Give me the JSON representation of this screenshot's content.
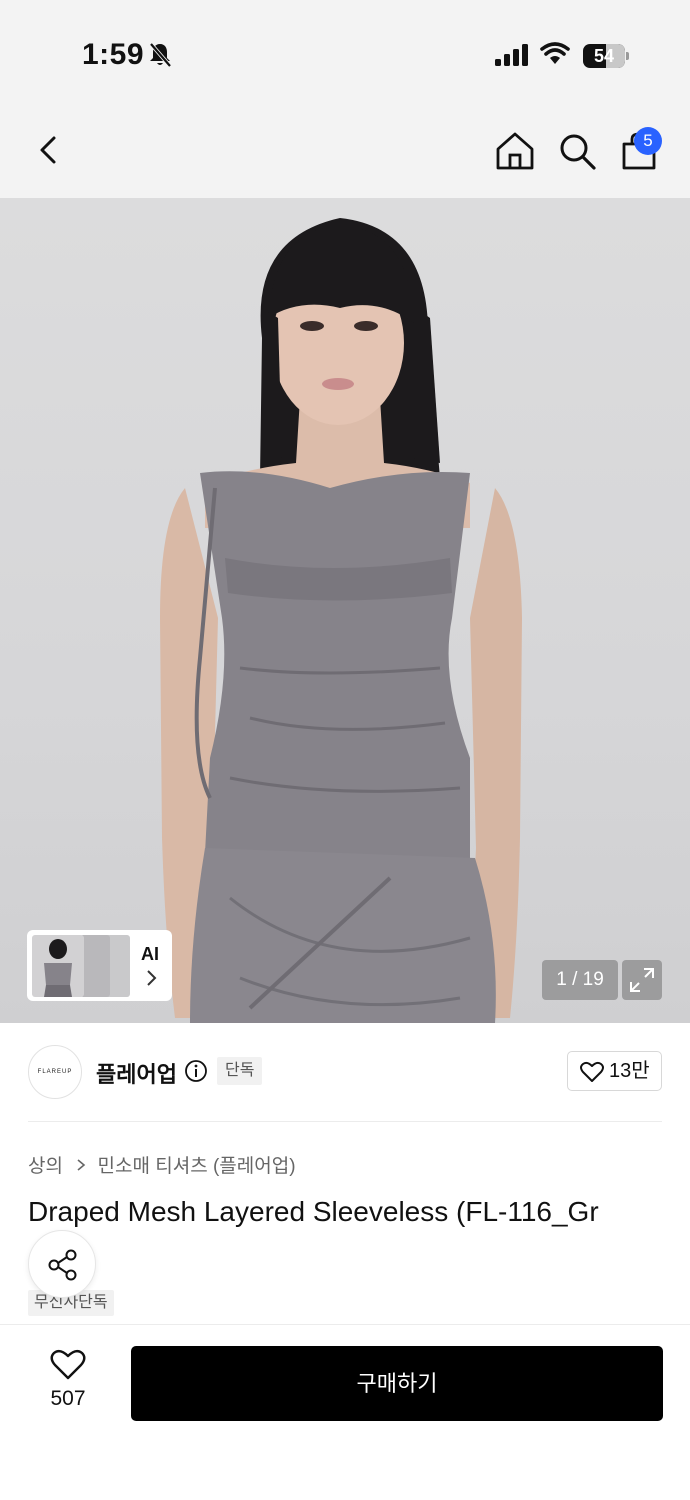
{
  "status_bar": {
    "time": "1:59",
    "battery": "54",
    "battery_level": 0.54,
    "icons": [
      "bell-slash-icon",
      "signal-icon",
      "wifi-icon",
      "battery-icon"
    ]
  },
  "nav": {
    "icons": [
      "back-chevron-icon",
      "home-icon",
      "search-icon",
      "shopping-bag-icon"
    ],
    "cart_count": "5"
  },
  "gallery": {
    "ai_label": "AI",
    "counter": "1 / 19",
    "current": 1,
    "total": 19
  },
  "brand": {
    "logo_text": "FLAREUP",
    "name": "플레어업",
    "exclusive_tag": "단독",
    "like_count": "13만"
  },
  "breadcrumb": {
    "category": "상의",
    "subcategory": "민소매 티셔츠 (플레어업)"
  },
  "product": {
    "title": "Draped Mesh Layered Sleeveless (FL-116_Gr",
    "tag": "무신사단독"
  },
  "bottom_bar": {
    "wish_count": "507",
    "buy_label": "구매하기"
  },
  "colors": {
    "badge_blue": "#2962ff",
    "buy_button": "#000000",
    "background": "#ffffff",
    "top_bar": "#f3f3f3"
  }
}
